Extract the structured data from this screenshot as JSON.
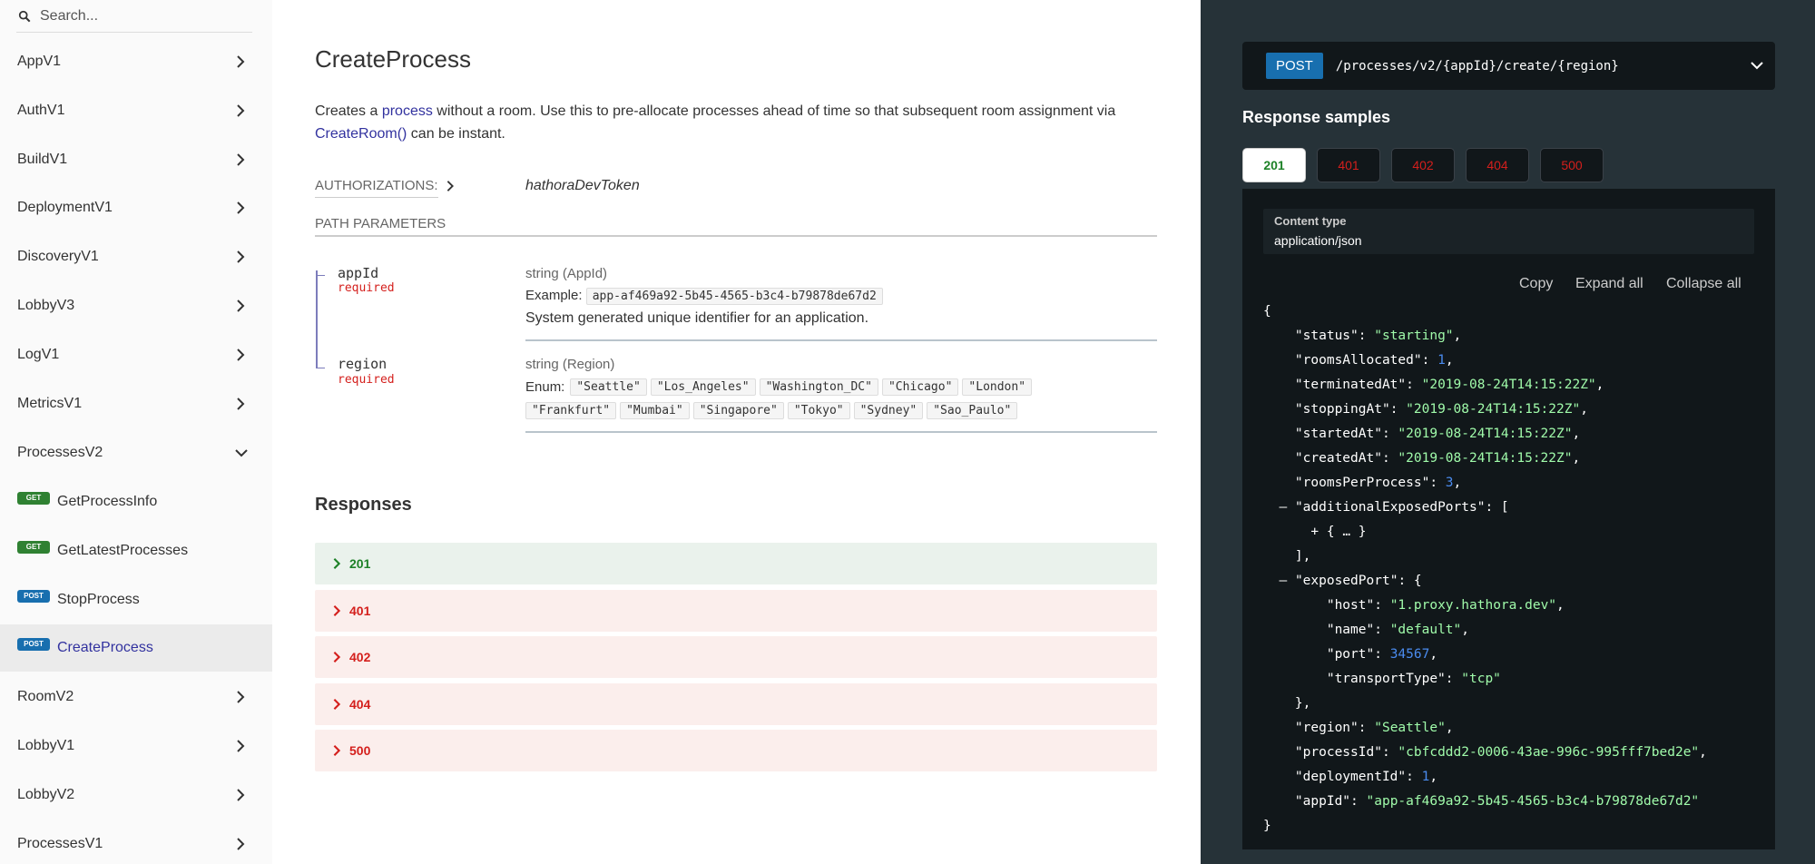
{
  "sidebar": {
    "search_placeholder": "Search...",
    "groups": [
      {
        "label": "AppV1"
      },
      {
        "label": "AuthV1"
      },
      {
        "label": "BuildV1"
      },
      {
        "label": "DeploymentV1"
      },
      {
        "label": "DiscoveryV1"
      },
      {
        "label": "LobbyV3"
      },
      {
        "label": "LogV1"
      },
      {
        "label": "MetricsV1"
      },
      {
        "label": "ProcessesV2"
      },
      {
        "label": "RoomV2"
      },
      {
        "label": "LobbyV1"
      },
      {
        "label": "LobbyV2"
      },
      {
        "label": "ProcessesV1"
      }
    ],
    "subitems": [
      {
        "method": "GET",
        "label": "GetProcessInfo"
      },
      {
        "method": "GET",
        "label": "GetLatestProcesses"
      },
      {
        "method": "POST",
        "label": "StopProcess"
      },
      {
        "method": "POST",
        "label": "CreateProcess"
      }
    ]
  },
  "operation": {
    "title": "CreateProcess",
    "desc_1": "Creates a ",
    "desc_link_1": "process",
    "desc_2": " without a room. Use this to pre-allocate processes ahead of time so that subsequent room assignment via ",
    "desc_link_2": "CreateRoom()",
    "desc_3": " can be instant.",
    "auth_label": "Authorizations:",
    "auth_value": "hathoraDevToken",
    "params_label": "Path Parameters",
    "params": {
      "appId": {
        "name": "appId",
        "required": "required",
        "type": "string (AppId)",
        "example_label": "Example:",
        "example": "app-af469a92-5b45-4565-b3c4-b79878de67d2",
        "desc": "System generated unique identifier for an application."
      },
      "region": {
        "name": "region",
        "required": "required",
        "type": "string (Region)",
        "enum_label": "Enum:",
        "enum_line1": [
          "\"Seattle\"",
          "\"Los_Angeles\"",
          "\"Washington_DC\"",
          "\"Chicago\"",
          "\"London\""
        ],
        "enum_line2": [
          "\"Frankfurt\"",
          "\"Mumbai\"",
          "\"Singapore\"",
          "\"Tokyo\"",
          "\"Sydney\"",
          "\"Sao_Paulo\""
        ]
      }
    },
    "responses_title": "Responses",
    "responses": [
      "201",
      "401",
      "402",
      "404",
      "500"
    ]
  },
  "panel": {
    "method": "POST",
    "path": "/processes/v2/{appId}/create/{region}",
    "samples_title": "Response samples",
    "tabs": [
      "201",
      "401",
      "402",
      "404",
      "500"
    ],
    "content_type_label": "Content type",
    "content_type": "application/json",
    "copy": "Copy",
    "expand_all": "Expand all",
    "collapse_all": "Collapse all",
    "json": {
      "status": "\"starting\"",
      "roomsAllocated": "1",
      "terminatedAt": "\"2019-08-24T14:15:22Z\"",
      "stoppingAt": "\"2019-08-24T14:15:22Z\"",
      "startedAt": "\"2019-08-24T14:15:22Z\"",
      "createdAt": "\"2019-08-24T14:15:22Z\"",
      "roomsPerProcess": "3",
      "collapsed": "{ … }",
      "host": "\"1.proxy.hathora.dev\"",
      "name": "\"default\"",
      "port": "34567",
      "transportType": "\"tcp\"",
      "region": "\"Seattle\"",
      "processId": "\"cbfcddd2-0006-43ae-996c-995fff7bed2e\"",
      "deploymentId": "1",
      "appId": "\"app-af469a92-5b45-4565-b3c4-b79878de67d2\""
    }
  },
  "colors": {
    "get": "#2F8132",
    "post": "#186FAF",
    "link": "#32329f",
    "error": "#d41f1c",
    "success": "#1d8127",
    "panel_bg": "#263238"
  }
}
